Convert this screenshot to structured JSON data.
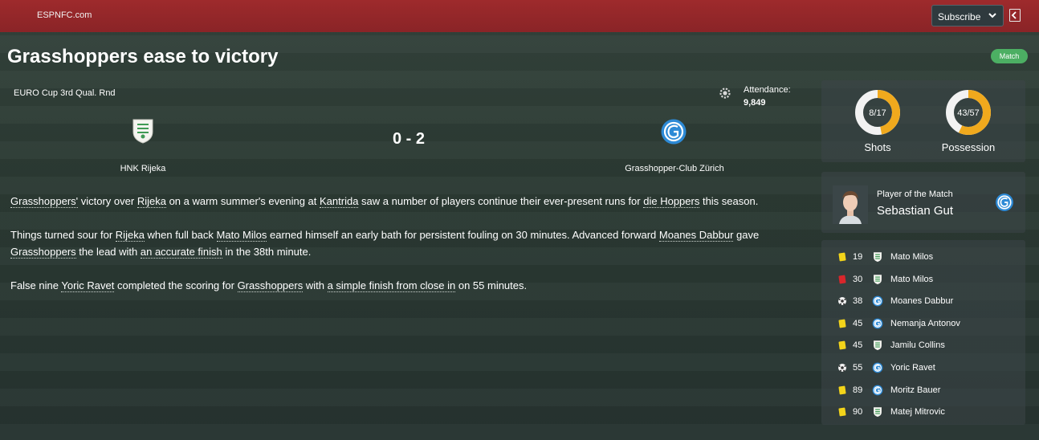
{
  "topbar": {
    "site_name": "ESPNFC.com",
    "subscribe_label": "Subscribe"
  },
  "article": {
    "title": "Grasshoppers ease to victory",
    "badge": "Match"
  },
  "match": {
    "competition": "EURO Cup 3rd Qual. Rnd",
    "attendance_label": "Attendance:",
    "attendance_value": "9,849",
    "score": "0 - 2",
    "home_team": "HNK Rijeka",
    "away_team": "Grasshopper-Club Zürich"
  },
  "report": {
    "p1": [
      {
        "t": "Grasshoppers'",
        "link": true
      },
      {
        "t": " victory over "
      },
      {
        "t": "Rijeka",
        "link": true
      },
      {
        "t": " on a warm summer's evening at "
      },
      {
        "t": "Kantrida",
        "link": true
      },
      {
        "t": " saw a number of players continue their ever-present runs for "
      },
      {
        "t": "die Hoppers",
        "link": true
      },
      {
        "t": " this season."
      }
    ],
    "p2": [
      {
        "t": "Things turned sour for "
      },
      {
        "t": "Rijeka",
        "link": true
      },
      {
        "t": " when full back "
      },
      {
        "t": "Mato Milos",
        "link": true
      },
      {
        "t": " earned himself an early bath for persistent fouling on 30 minutes. Advanced forward "
      },
      {
        "t": "Moanes Dabbur",
        "link": true
      },
      {
        "t": " gave "
      },
      {
        "t": "Grasshoppers",
        "link": true
      },
      {
        "t": " the lead with "
      },
      {
        "t": "an accurate finish",
        "link": true
      },
      {
        "t": " in the 38th minute."
      }
    ],
    "p3": [
      {
        "t": "False nine "
      },
      {
        "t": "Yoric Ravet",
        "link": true
      },
      {
        "t": " completed the scoring for "
      },
      {
        "t": "Grasshoppers",
        "link": true
      },
      {
        "t": " with "
      },
      {
        "t": "a simple finish from close in",
        "link": true
      },
      {
        "t": " on 55 minutes."
      }
    ]
  },
  "stats": {
    "shots": {
      "text": "8/17",
      "fraction": 0.47,
      "label": "Shots"
    },
    "possession": {
      "text": "43/57",
      "fraction": 0.57,
      "label": "Possession"
    }
  },
  "potm": {
    "title": "Player of the Match",
    "name": "Sebastian Gut"
  },
  "events": [
    {
      "type": "yellow",
      "minute": "19",
      "team": "home",
      "player": "Mato Milos"
    },
    {
      "type": "red",
      "minute": "30",
      "team": "home",
      "player": "Mato Milos"
    },
    {
      "type": "goal",
      "minute": "38",
      "team": "away",
      "player": "Moanes Dabbur"
    },
    {
      "type": "yellow",
      "minute": "45",
      "team": "away",
      "player": "Nemanja Antonov"
    },
    {
      "type": "yellow",
      "minute": "45",
      "team": "home",
      "player": "Jamilu Collins"
    },
    {
      "type": "goal",
      "minute": "55",
      "team": "away",
      "player": "Yoric Ravet"
    },
    {
      "type": "yellow",
      "minute": "89",
      "team": "away",
      "player": "Moritz Bauer"
    },
    {
      "type": "yellow",
      "minute": "90",
      "team": "home",
      "player": "Matej Mitrovic"
    }
  ],
  "colors": {
    "topbar": "#8a2427",
    "badge": "#4caf63",
    "donut_accent": "#f0a91d",
    "yellow_card": "#f3d41a",
    "red_card": "#d9262b",
    "away_blue": "#2d8ad6"
  },
  "icons": {
    "home_crest": "rijeka-crest-icon",
    "away_crest": "grasshoppers-crest-icon",
    "gear": "gear-icon",
    "chevron": "chevron-down-icon",
    "collapse": "collapse-panel-icon"
  }
}
